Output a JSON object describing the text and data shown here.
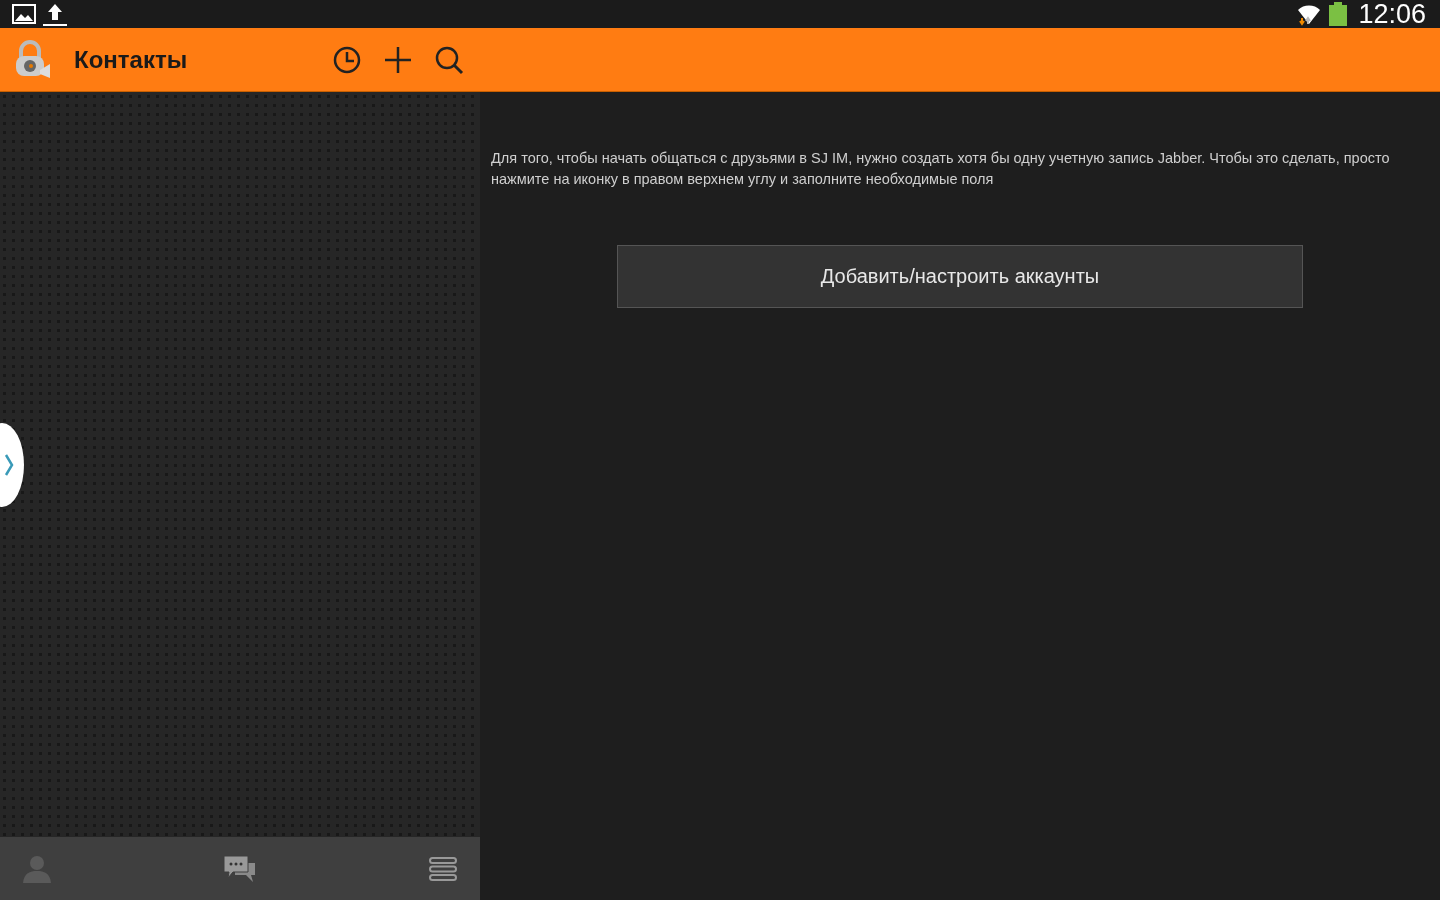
{
  "status_bar": {
    "time": "12:06"
  },
  "action_bar": {
    "title": "Контакты"
  },
  "message": "Для того, чтобы начать общаться с друзьями в SJ IM, нужно создать хотя бы одну учетную запись Jabber. Чтобы это сделать, просто нажмите на иконку в правом верхнем углу и заполните необходимые поля",
  "button": "Добавить/настроить аккаунты"
}
